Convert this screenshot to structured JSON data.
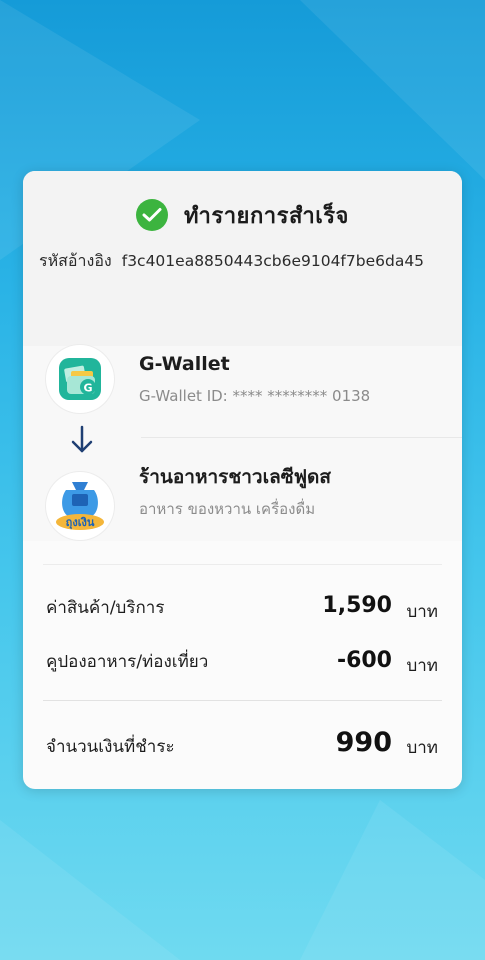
{
  "status": {
    "title": "ทำรายการสำเร็จ",
    "icon": "check-circle-icon"
  },
  "reference": {
    "label": "รหัสอ้างอิง",
    "code": "f3c401ea8850443cb6e9104f7be6da45"
  },
  "from": {
    "name": "G-Wallet",
    "detail": "G-Wallet ID: **** ********   0138",
    "icon": "g-wallet-logo"
  },
  "to": {
    "name": "ร้านอาหารชาวเลซีฟูดส",
    "detail": "อาหาร ของหวาน เครื่องดื่ม",
    "icon": "thung-ngern-logo",
    "logo_text": "ถุงเงิน"
  },
  "summary": {
    "subtotal": {
      "label": "ค่าสินค้า/บริการ",
      "amount": "1,590",
      "unit": "บาท"
    },
    "coupon": {
      "label": "คูปองอาหาร/ท่องเที่ยว",
      "amount": "-600",
      "unit": "บาท"
    },
    "total": {
      "label": "จำนวนเงินที่ชำระ",
      "amount": "990",
      "unit": "บาท"
    }
  },
  "colors": {
    "success": "#3cb43f",
    "arrow": "#1f3f73",
    "background_top": "#159bd8",
    "background_bottom": "#6fdaf0"
  }
}
